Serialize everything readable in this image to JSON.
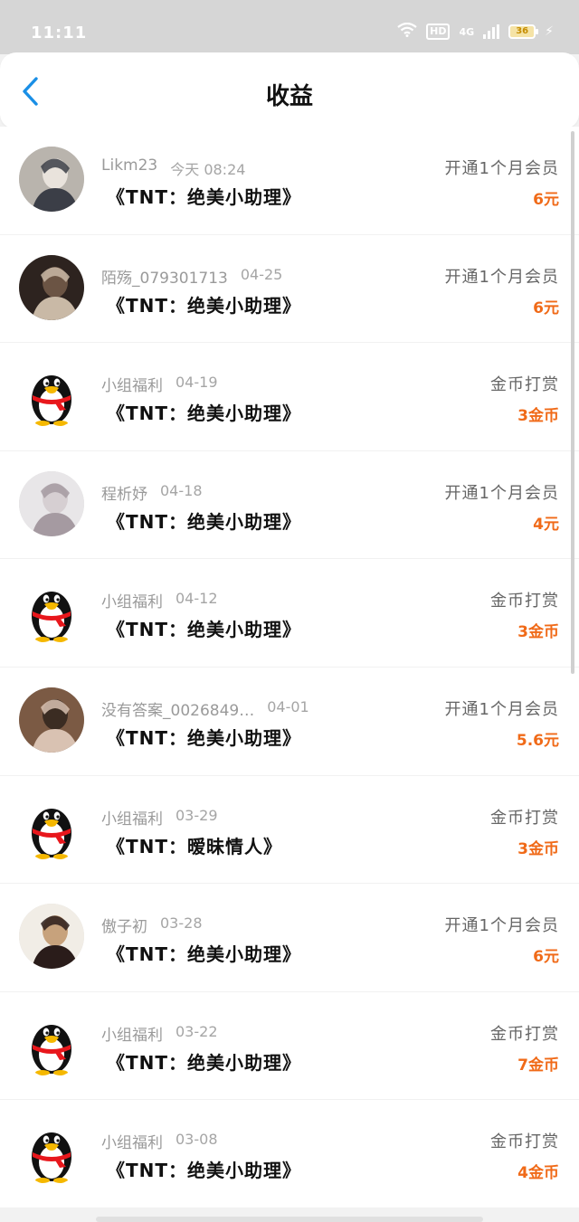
{
  "status_bar": {
    "time": "11:11",
    "network": "HD",
    "signal": "4G",
    "battery": "36"
  },
  "nav": {
    "title": "收益"
  },
  "colors": {
    "accent": "#1a8fe6",
    "amount": "#f06a18"
  },
  "items": [
    {
      "name": "Likm23",
      "date": "今天 08:24",
      "book": "《TNT：绝美小助理》",
      "type": "开通1个月会员",
      "amount": "6元",
      "avatar": "photo"
    },
    {
      "name": "陌殇_079301713",
      "date": "04-25",
      "book": "《TNT：绝美小助理》",
      "type": "开通1个月会员",
      "amount": "6元",
      "avatar": "photo"
    },
    {
      "name": "小组福利",
      "date": "04-19",
      "book": "《TNT：绝美小助理》",
      "type": "金币打赏",
      "amount": "3金币",
      "avatar": "penguin-icon"
    },
    {
      "name": "程析妤",
      "date": "04-18",
      "book": "《TNT：绝美小助理》",
      "type": "开通1个月会员",
      "amount": "4元",
      "avatar": "photo"
    },
    {
      "name": "小组福利",
      "date": "04-12",
      "book": "《TNT：绝美小助理》",
      "type": "金币打赏",
      "amount": "3金币",
      "avatar": "penguin-icon"
    },
    {
      "name": "没有答案_0026849…",
      "date": "04-01",
      "book": "《TNT：绝美小助理》",
      "type": "开通1个月会员",
      "amount": "5.6元",
      "avatar": "photo"
    },
    {
      "name": "小组福利",
      "date": "03-29",
      "book": "《TNT：暧昧情人》",
      "type": "金币打赏",
      "amount": "3金币",
      "avatar": "penguin-icon"
    },
    {
      "name": "傲子初",
      "date": "03-28",
      "book": "《TNT：绝美小助理》",
      "type": "开通1个月会员",
      "amount": "6元",
      "avatar": "photo"
    },
    {
      "name": "小组福利",
      "date": "03-22",
      "book": "《TNT：绝美小助理》",
      "type": "金币打赏",
      "amount": "7金币",
      "avatar": "penguin-icon"
    },
    {
      "name": "小组福利",
      "date": "03-08",
      "book": "《TNT：绝美小助理》",
      "type": "金币打赏",
      "amount": "4金币",
      "avatar": "penguin-icon"
    }
  ]
}
